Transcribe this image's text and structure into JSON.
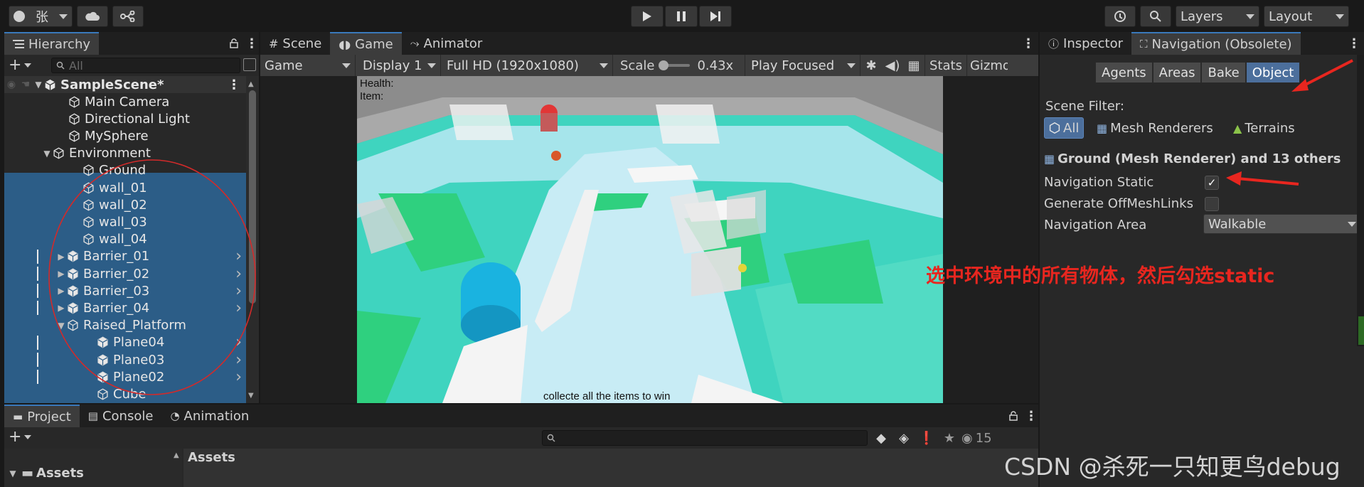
{
  "toolbar": {
    "account_label": "张",
    "layers_label": "Layers",
    "layout_label": "Layout"
  },
  "hierarchy": {
    "tab_label": "Hierarchy",
    "search_placeholder": "All",
    "scene_name": "SampleScene*",
    "items": [
      {
        "label": "Main Camera"
      },
      {
        "label": "Directional Light"
      },
      {
        "label": "MySphere"
      },
      {
        "label": "Environment"
      },
      {
        "label": "Ground"
      },
      {
        "label": "wall_01"
      },
      {
        "label": "wall_02"
      },
      {
        "label": "wall_03"
      },
      {
        "label": "wall_04"
      },
      {
        "label": "Barrier_01"
      },
      {
        "label": "Barrier_02"
      },
      {
        "label": "Barrier_03"
      },
      {
        "label": "Barrier_04"
      },
      {
        "label": "Raised_Platform"
      },
      {
        "label": "Plane04"
      },
      {
        "label": "Plane03"
      },
      {
        "label": "Plane02"
      },
      {
        "label": "Cube"
      }
    ]
  },
  "center": {
    "tabs": [
      {
        "label": "Scene"
      },
      {
        "label": "Game"
      },
      {
        "label": "Animator"
      }
    ],
    "game_dropdown": "Game",
    "display_dropdown": "Display 1",
    "resolution_dropdown": "Full HD (1920x1080)",
    "scale_label": "Scale",
    "scale_value": "0.43x",
    "play_mode": "Play Focused",
    "stats_label": "Stats",
    "gizmos_label": "Gizmo",
    "hud_health": "Health:",
    "hud_item": "Item:",
    "hud_bottom": "collecte all the items to win"
  },
  "inspector": {
    "tabs": [
      {
        "label": "Inspector"
      },
      {
        "label": "Navigation (Obsolete)"
      }
    ],
    "nav_buttons": [
      {
        "label": "Agents"
      },
      {
        "label": "Areas"
      },
      {
        "label": "Bake"
      },
      {
        "label": "Object"
      }
    ],
    "scene_filter_label": "Scene Filter:",
    "filter_all": "All",
    "filter_mesh": "Mesh Renderers",
    "filter_terrains": "Terrains",
    "selection_title": "Ground (Mesh Renderer) and 13 others",
    "nav_static_label": "Navigation Static",
    "offmesh_label": "Generate OffMeshLinks",
    "nav_area_label": "Navigation Area",
    "nav_area_value": "Walkable"
  },
  "annotation": {
    "text": "选中环境中的所有物体，然后勾选static",
    "color": "#e8261f"
  },
  "bottom": {
    "tabs": [
      {
        "label": "Project"
      },
      {
        "label": "Console"
      },
      {
        "label": "Animation"
      }
    ],
    "assets_tree": "Assets",
    "assets_header": "Assets",
    "hidden_count": "15"
  },
  "watermark": "CSDN @杀死一只知更鸟debug",
  "colors": {
    "accent": "#3a79bb",
    "selection": "#2c5d87",
    "object_button": "#4c6f9c",
    "annotation_red": "#e8261f"
  }
}
